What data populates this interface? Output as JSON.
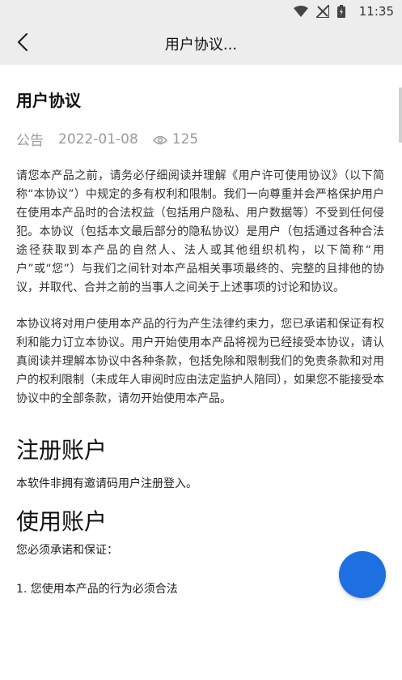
{
  "status_bar": {
    "time": "11:35",
    "icons": [
      "wifi-icon",
      "signal-off-icon",
      "battery-icon"
    ]
  },
  "app_bar": {
    "title": "用户协议...",
    "back_icon": "chevron-left-icon"
  },
  "article": {
    "title": "用户协议",
    "category": "公告",
    "date": "2022-01-08",
    "views": "125",
    "paragraphs": [
      "请您本产品之前，请务必仔细阅读并理解《用户许可使用协议》（以下简称“本协议”）中规定的多有权利和限制。我们一向尊重并会严格保护用户在使用本产品时的合法权益（包括用户隐私、用户数据等）不受到任何侵犯。本协议（包括本文最后部分的隐私协议）是用户（包括通过各种合法途径获取到本产品的自然人、法人或其他组织机构，以下简称“用户”或“您”）与我们之间针对本产品相关事项最终的、完整的且排他的协议，并取代、合并之前的当事人之间关于上述事项的讨论和协议。",
      "本协议将对用户使用本产品的行为产生法律约束力，您已承诺和保证有权利和能力订立本协议。用户开始使用本产品将视为已经接受本协议，请认真阅读并理解本协议中各种条款，包括免除和限制我们的免责条款和对用户的权利限制（未成年人审阅时应由法定监护人陪同），如果您不能接受本协议中的全部条款，请勿开始使用本产品。"
    ],
    "section1": {
      "heading": "注册账户",
      "text": "本软件非拥有邀请码用户注册登入。"
    },
    "section2": {
      "heading": "使用账户",
      "text": "您必须承诺和保证：",
      "list_item": "1. 您使用本产品的行为必须合法"
    }
  },
  "colors": {
    "header_bg": "#ededed",
    "fab": "#1e6fe0",
    "meta_text": "#9a9a9a"
  }
}
